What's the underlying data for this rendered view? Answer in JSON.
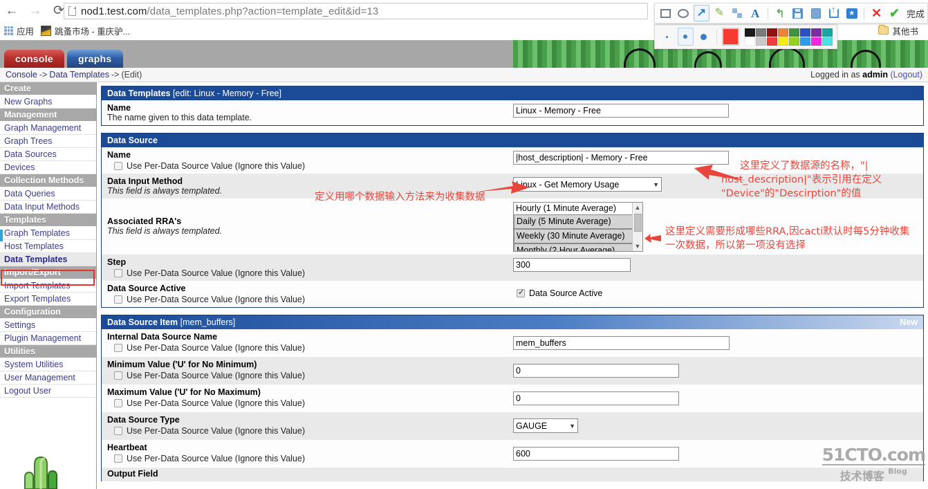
{
  "browser": {
    "url_main": "nod1.test.com",
    "url_path": "/data_templates.php?action=template_edit&id=13",
    "back_icon": "←",
    "forward_icon": "→",
    "reload_icon": "⟳",
    "bookmarks": [
      {
        "label": "应用",
        "icon": "apps-grid-icon"
      },
      {
        "label": "跳蚤市场 - 重庆驴...",
        "icon": "favicon"
      }
    ],
    "bookmarks_right": {
      "label": "其他书",
      "icon": "folder-icon"
    }
  },
  "annot_toolbar": {
    "tools": [
      {
        "name": "rectangle-tool",
        "active": false
      },
      {
        "name": "ellipse-tool",
        "active": false
      },
      {
        "name": "arrow-tool",
        "active": true
      },
      {
        "name": "brush-tool",
        "active": false
      },
      {
        "name": "mosaic-tool",
        "active": false
      },
      {
        "name": "text-tool",
        "active": false
      },
      {
        "name": "undo-tool",
        "active": false
      },
      {
        "name": "save-tool",
        "active": false
      },
      {
        "name": "pin-tool",
        "active": false
      },
      {
        "name": "share-tool",
        "active": false
      },
      {
        "name": "favorite-tool",
        "active": false
      },
      {
        "name": "cancel-tool",
        "active": false
      },
      {
        "name": "confirm-tool",
        "active": false
      }
    ],
    "done_label": "完成",
    "palette": {
      "sizes": [
        {
          "name": "size-small",
          "px": 3,
          "active": false
        },
        {
          "name": "size-medium",
          "px": 6,
          "active": true
        },
        {
          "name": "size-large",
          "px": 9,
          "active": false
        }
      ],
      "current_color": "#f53a32",
      "swatches_row1": [
        "#1b1b1b",
        "#7a7a7a",
        "#8e1414",
        "#e8853a",
        "#3f9340",
        "#2f4fc0",
        "#7a2fa0",
        "#1aa5a5"
      ],
      "swatches_row2": [
        "#ffffff",
        "#c9c9c9",
        "#f23b3b",
        "#f5ec1b",
        "#96d022",
        "#2f9bf0",
        "#f229e0",
        "#4ae0e8"
      ]
    }
  },
  "cacti": {
    "tabs": [
      {
        "label": "console",
        "name": "tab-console"
      },
      {
        "label": "graphs",
        "name": "tab-graphs"
      }
    ],
    "breadcrumb": {
      "items": [
        "Console",
        "Data Templates",
        "(Edit)"
      ],
      "separator": "->"
    },
    "login": {
      "prefix": "Logged in as ",
      "user": "admin",
      "logout": "(Logout)"
    }
  },
  "sidebar": {
    "groups": [
      {
        "header": "Create",
        "items": [
          {
            "label": "New Graphs",
            "selected": false
          }
        ]
      },
      {
        "header": "Management",
        "items": [
          {
            "label": "Graph Management",
            "selected": false
          },
          {
            "label": "Graph Trees",
            "selected": false
          },
          {
            "label": "Data Sources",
            "selected": false
          },
          {
            "label": "Devices",
            "selected": false
          }
        ]
      },
      {
        "header": "Collection Methods",
        "items": [
          {
            "label": "Data Queries",
            "selected": false
          },
          {
            "label": "Data Input Methods",
            "selected": false
          }
        ]
      },
      {
        "header": "Templates",
        "items": [
          {
            "label": "Graph Templates",
            "selected": false
          },
          {
            "label": "Host Templates",
            "selected": false
          },
          {
            "label": "Data Templates",
            "selected": true
          }
        ]
      },
      {
        "header": "Import/Export",
        "items": [
          {
            "label": "Import Templates",
            "selected": false
          },
          {
            "label": "Export Templates",
            "selected": false
          }
        ]
      },
      {
        "header": "Configuration",
        "items": [
          {
            "label": "Settings",
            "selected": false
          },
          {
            "label": "Plugin Management",
            "selected": false
          }
        ]
      },
      {
        "header": "Utilities",
        "items": [
          {
            "label": "System Utilities",
            "selected": false
          },
          {
            "label": "User Management",
            "selected": false
          },
          {
            "label": "Logout User",
            "selected": false
          }
        ]
      }
    ]
  },
  "panels": {
    "data_templates": {
      "title": "Data Templates",
      "title_suffix": "[edit: Linux - Memory - Free]",
      "name_label": "Name",
      "name_desc": "The name given to this data template.",
      "name_value": "Linux - Memory - Free"
    },
    "data_source": {
      "title": "Data Source",
      "per_ds_label": "Use Per-Data Source Value (Ignore this Value)",
      "rows": {
        "name": {
          "label": "Name",
          "value": "|host_description| - Memory - Free",
          "checked": false
        },
        "data_input_method": {
          "label": "Data Input Method",
          "desc": "This field is always templated.",
          "value": "Linux - Get Memory Usage"
        },
        "associated_rras": {
          "label": "Associated RRA's",
          "desc": "This field is always templated.",
          "options": [
            {
              "label": "Hourly (1 Minute Average)",
              "selected": false
            },
            {
              "label": "Daily (5 Minute Average)",
              "selected": true
            },
            {
              "label": "Weekly (30 Minute Average)",
              "selected": true
            },
            {
              "label": "Monthly (2 Hour Average)",
              "selected": true
            }
          ]
        },
        "step": {
          "label": "Step",
          "value": "300",
          "checked": false
        },
        "data_source_active": {
          "label": "Data Source Active",
          "checkbox_label": "Data Source Active",
          "checked": true,
          "per_ds_checked": false
        }
      }
    },
    "data_source_item": {
      "title": "Data Source Item",
      "title_suffix": "[mem_buffers]",
      "right_label": "New",
      "per_ds_label": "Use Per-Data Source Value (Ignore this Value)",
      "rows": [
        {
          "label": "Internal Data Source Name",
          "value": "mem_buffers",
          "type": "text",
          "checked": false
        },
        {
          "label": "Minimum Value ('U' for No Minimum)",
          "value": "0",
          "type": "text",
          "checked": false
        },
        {
          "label": "Maximum Value ('U' for No Maximum)",
          "value": "0",
          "type": "text",
          "checked": false
        },
        {
          "label": "Data Source Type",
          "value": "GAUGE",
          "type": "select",
          "checked": false
        },
        {
          "label": "Heartbeat",
          "value": "600",
          "type": "text",
          "checked": false
        },
        {
          "label": "Output Field",
          "value": "",
          "type": "text",
          "checked": false
        }
      ]
    }
  },
  "annotations": {
    "color": "#e8463c",
    "note_input_method": "定义用哪个数据输入方法来为收集数据",
    "note_name_line1": "这里定义了数据源的名称，\"|",
    "note_name_line2": "host_description|\"表示引用在定义",
    "note_name_line3": "\"Device\"的\"Descirption\"的值",
    "note_rra_line1": "这里定义需要形成哪些RRA,因cacti默认时每5分钟收集",
    "note_rra_line2": "一次数据，所以第一项没有选择"
  },
  "watermark": {
    "top": "51CTO.com",
    "bottom": "技术博客",
    "bottom_small": "Blog"
  }
}
